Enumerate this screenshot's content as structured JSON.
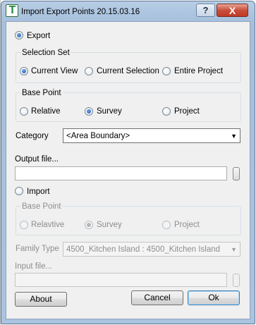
{
  "window": {
    "title": "Import Export Points 20.15.03.16",
    "app_icon": "revit-tools-icon",
    "help_label": "?",
    "close_label": "X"
  },
  "export": {
    "label": "Export",
    "selected": true,
    "selection_set": {
      "legend": "Selection Set",
      "options": [
        "Current View",
        "Current Selection",
        "Entire Project"
      ],
      "selected": "Current View"
    },
    "base_point": {
      "legend": "Base Point",
      "options": [
        "Relative",
        "Survey",
        "Project"
      ],
      "selected": "Survey"
    },
    "category": {
      "label": "Category",
      "value": "<Area Boundary>"
    },
    "output_file": {
      "label": "Output file...",
      "value": ""
    }
  },
  "import": {
    "label": "Import",
    "selected": false,
    "base_point": {
      "legend": "Base Point",
      "options": [
        "Relavtive",
        "Survey",
        "Project"
      ],
      "selected": "Survey"
    },
    "family_type": {
      "label": "Family Type",
      "value": "4500_Kitchen Island : 4500_Kitchen Island"
    },
    "input_file": {
      "label": "Input file...",
      "value": ""
    }
  },
  "buttons": {
    "about": "About",
    "cancel": "Cancel",
    "ok": "Ok"
  },
  "colors": {
    "title_bar": "#aac3df",
    "close_button": "#c9503b",
    "radio_selected": "#1f5aa8",
    "default_button_border": "#3c7fb1"
  }
}
